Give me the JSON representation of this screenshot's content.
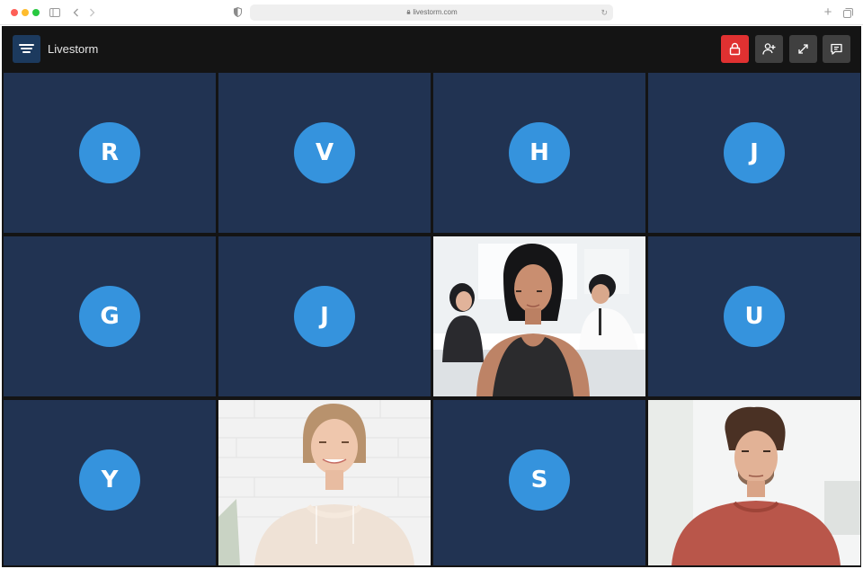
{
  "browser": {
    "url": "livestorm.com",
    "back_icon": "chevron-left-icon",
    "forward_icon": "chevron-right-icon",
    "sidebar_icon": "sidebar-icon",
    "shield_icon": "shield-icon",
    "lock_icon": "lock-icon",
    "reload_icon": "reload-icon",
    "new_tab_icon": "plus-icon",
    "tabs_icon": "tabs-icon"
  },
  "app": {
    "title": "Livestorm",
    "logo_icon": "livestorm-logo-icon"
  },
  "toolbar": {
    "lock_icon": "lock-icon",
    "add_participant_icon": "user-plus-icon",
    "fullscreen_icon": "expand-icon",
    "chat_icon": "chat-icon",
    "accent_color": "#e03131"
  },
  "tiles": [
    {
      "type": "avatar",
      "initial": "R"
    },
    {
      "type": "avatar",
      "initial": "V"
    },
    {
      "type": "avatar",
      "initial": "H"
    },
    {
      "type": "avatar",
      "initial": "J"
    },
    {
      "type": "avatar",
      "initial": "G"
    },
    {
      "type": "avatar",
      "initial": "J"
    },
    {
      "type": "video"
    },
    {
      "type": "avatar",
      "initial": "U"
    },
    {
      "type": "avatar",
      "initial": "Y"
    },
    {
      "type": "video"
    },
    {
      "type": "avatar",
      "initial": "S"
    },
    {
      "type": "video"
    }
  ],
  "colors": {
    "tile_background": "#213352",
    "avatar_background": "#3593dd",
    "app_background": "#141414"
  }
}
